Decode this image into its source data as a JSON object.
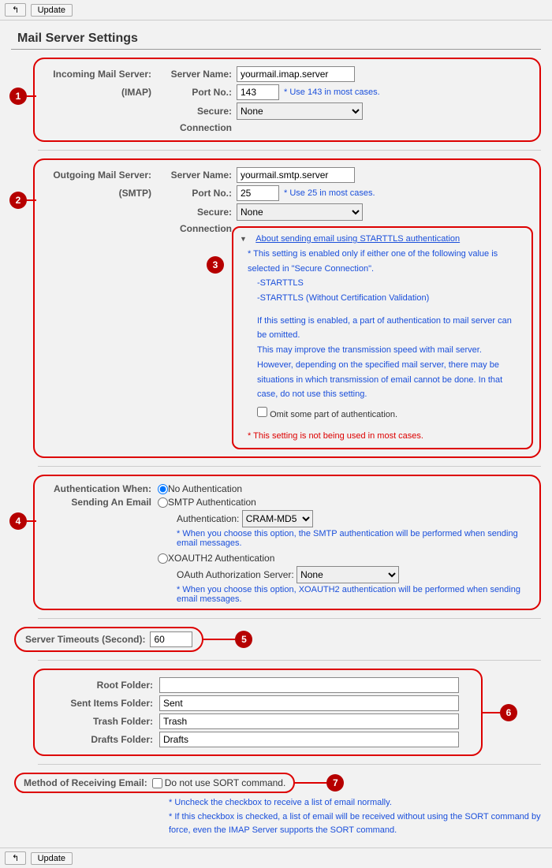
{
  "toolbar": {
    "back": "↰",
    "update": "Update"
  },
  "title": "Mail Server Settings",
  "callouts": {
    "n1": "1",
    "n2": "2",
    "n3": "3",
    "n4": "4",
    "n5": "5",
    "n6": "6",
    "n7": "7"
  },
  "incoming": {
    "heading": "Incoming Mail Server:",
    "sub": "(IMAP)",
    "server_lbl": "Server Name:",
    "server_val": "yourmail.imap.server",
    "port_lbl": "Port No.:",
    "port_val": "143",
    "port_note": "Use 143 in most cases.",
    "secure_lbl": "Secure:",
    "secure_sub": "Connection",
    "secure_val": "None"
  },
  "outgoing": {
    "heading": "Outgoing Mail Server:",
    "sub": "(SMTP)",
    "server_lbl": "Server Name:",
    "server_val": "yourmail.smtp.server",
    "port_lbl": "Port No.:",
    "port_val": "25",
    "port_note": "Use 25 in most cases.",
    "secure_lbl": "Secure:",
    "secure_sub": "Connection",
    "secure_val": "None",
    "disclosure": "About sending email using STARTTLS authentication",
    "info1": "This setting is enabled only if either one of the following value is selected in \"Secure Connection\".",
    "info2": "-STARTTLS",
    "info3": "-STARTTLS (Without Certification Validation)",
    "info4": "If this setting is enabled, a part of authentication to mail server can be omitted.",
    "info5": "This may improve the transmission speed with mail server.",
    "info6": "However, depending on the specified mail server, there may be situations in which transmission of email cannot be done. In that case, do not use this setting.",
    "omit_label": "Omit some part of authentication.",
    "warn": "This setting is not being used in most cases."
  },
  "auth": {
    "heading": "Authentication When:",
    "sub": "Sending An Email",
    "opt_none": "No Authentication",
    "opt_smtp": "SMTP Authentication",
    "smtp_auth_lbl": "Authentication:",
    "smtp_auth_val": "CRAM-MD5",
    "smtp_note": "When you choose this option, the SMTP authentication will be performed when sending email messages.",
    "opt_xoauth": "XOAUTH2 Authentication",
    "oauth_lbl": "OAuth Authorization Server:",
    "oauth_val": "None",
    "oauth_note": "When you choose this option, XOAUTH2 authentication will be performed when sending email messages."
  },
  "timeout": {
    "lbl": "Server Timeouts (Second):",
    "val": "60"
  },
  "folders": {
    "root_lbl": "Root Folder:",
    "root_val": "",
    "sent_lbl": "Sent Items Folder:",
    "sent_val": "Sent",
    "trash_lbl": "Trash Folder:",
    "trash_val": "Trash",
    "drafts_lbl": "Drafts Folder:",
    "drafts_val": "Drafts"
  },
  "receiving": {
    "lbl": "Method of Receiving Email:",
    "check_lbl": "Do not use SORT command.",
    "note1": "Uncheck the checkbox to receive a list of email normally.",
    "note2": "If this checkbox is checked, a list of email will be received without using the SORT command by force, even the IMAP Server supports the SORT command."
  }
}
